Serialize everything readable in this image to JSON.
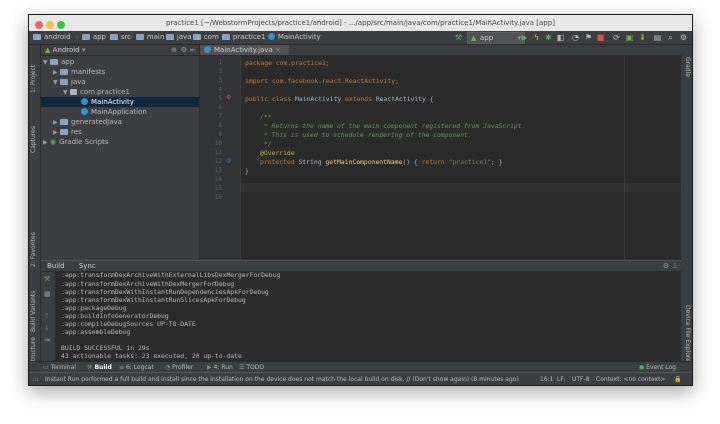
{
  "window": {
    "title": "practice1 [~/WebstormProjects/practice1/android] - .../app/src/main/java/com/practice1/MainActivity.java [app]"
  },
  "breadcrumbs": [
    "android",
    "app",
    "src",
    "main",
    "java",
    "com",
    "practice1",
    "MainActivity"
  ],
  "run_config": "app",
  "left_tool_windows": [
    "1: Project",
    "Captures",
    "2: Favorites",
    "Build Variants",
    "Z: Structure"
  ],
  "right_tool_windows": [
    "Gradle",
    "Device File Explorer"
  ],
  "project": {
    "view": "Android",
    "tree": [
      {
        "label": "app",
        "kind": "folder",
        "level": 0,
        "expanded": true
      },
      {
        "label": "manifests",
        "kind": "folder",
        "level": 1
      },
      {
        "label": "java",
        "kind": "folder",
        "level": 1,
        "expanded": true
      },
      {
        "label": "com.practice1",
        "kind": "package",
        "level": 2,
        "expanded": true
      },
      {
        "label": "MainActivity",
        "kind": "class",
        "level": 3,
        "selected": true
      },
      {
        "label": "MainApplication",
        "kind": "class",
        "level": 3
      },
      {
        "label": "generatedJava",
        "kind": "folder",
        "level": 1
      },
      {
        "label": "res",
        "kind": "folder",
        "level": 1
      },
      {
        "label": "Gradle Scripts",
        "kind": "gradle",
        "level": 0
      }
    ]
  },
  "editor": {
    "tab": "MainActivity.java",
    "line_numbers": [
      "1",
      "2",
      "3",
      "4",
      "5",
      "6",
      "7",
      "8",
      "9",
      "10",
      "11",
      "12",
      "13",
      "14",
      "15",
      "16"
    ],
    "code": {
      "l1": "package com.practice1;",
      "l3": "import com.facebook.react.ReactActivity;",
      "l5_kw1": "public class",
      "l5_name": " MainActivity ",
      "l5_kw2": "extends",
      "l5_rest": " ReactActivity {",
      "l7": "/**",
      "l8": " * Returns the name of the main component registered from JavaScript.",
      "l9": " * This is used to schedule rendering of the component.",
      "l10": " */",
      "l11": "@Override",
      "l12_kw": "protected",
      "l12_type": " String ",
      "l12_fn": "getMainComponentName",
      "l12_mid": "() { ",
      "l12_kw2": "return",
      "l12_str": " \"practice1\"",
      "l12_end": "; }",
      "l13": "}"
    }
  },
  "build_panel": {
    "tabs": [
      "Build",
      "Sync"
    ],
    "lines": [
      ":app:transformDexArchiveWithExternalLibsDexMergerForDebug",
      ":app:transformDexArchiveWithDexMergerForDebug",
      ":app:transformDexWithInstantRunDependenciesApkForDebug",
      ":app:transformDexWithInstantRunSlicesApkForDebug",
      ":app:packageDebug",
      ":app:buildInfoGeneratorDebug",
      ":app:compileDebugSources UP-TO-DATE",
      ":app:assembleDebug",
      "",
      "BUILD SUCCESSFUL in 29s",
      "43 actionable tasks: 23 executed, 20 up-to-date"
    ]
  },
  "bottom_tabs": [
    "Terminal",
    "Build",
    "6: Logcat",
    "Profiler",
    "4: Run",
    "TODO"
  ],
  "event_log": "Event Log",
  "status": {
    "message": "Instant Run performed a full build and install since the installation on the device does not match the local build on disk. // (Don't show again) (8 minutes ago)",
    "position": "16:1",
    "line_sep": "LF:",
    "encoding": "UTF-8",
    "context": "Context: <no context>"
  },
  "colors": {
    "accent": "#3592c4",
    "keyword": "#cc7832",
    "string": "#6a8759",
    "comment": "#629755",
    "function": "#ffc66d"
  }
}
